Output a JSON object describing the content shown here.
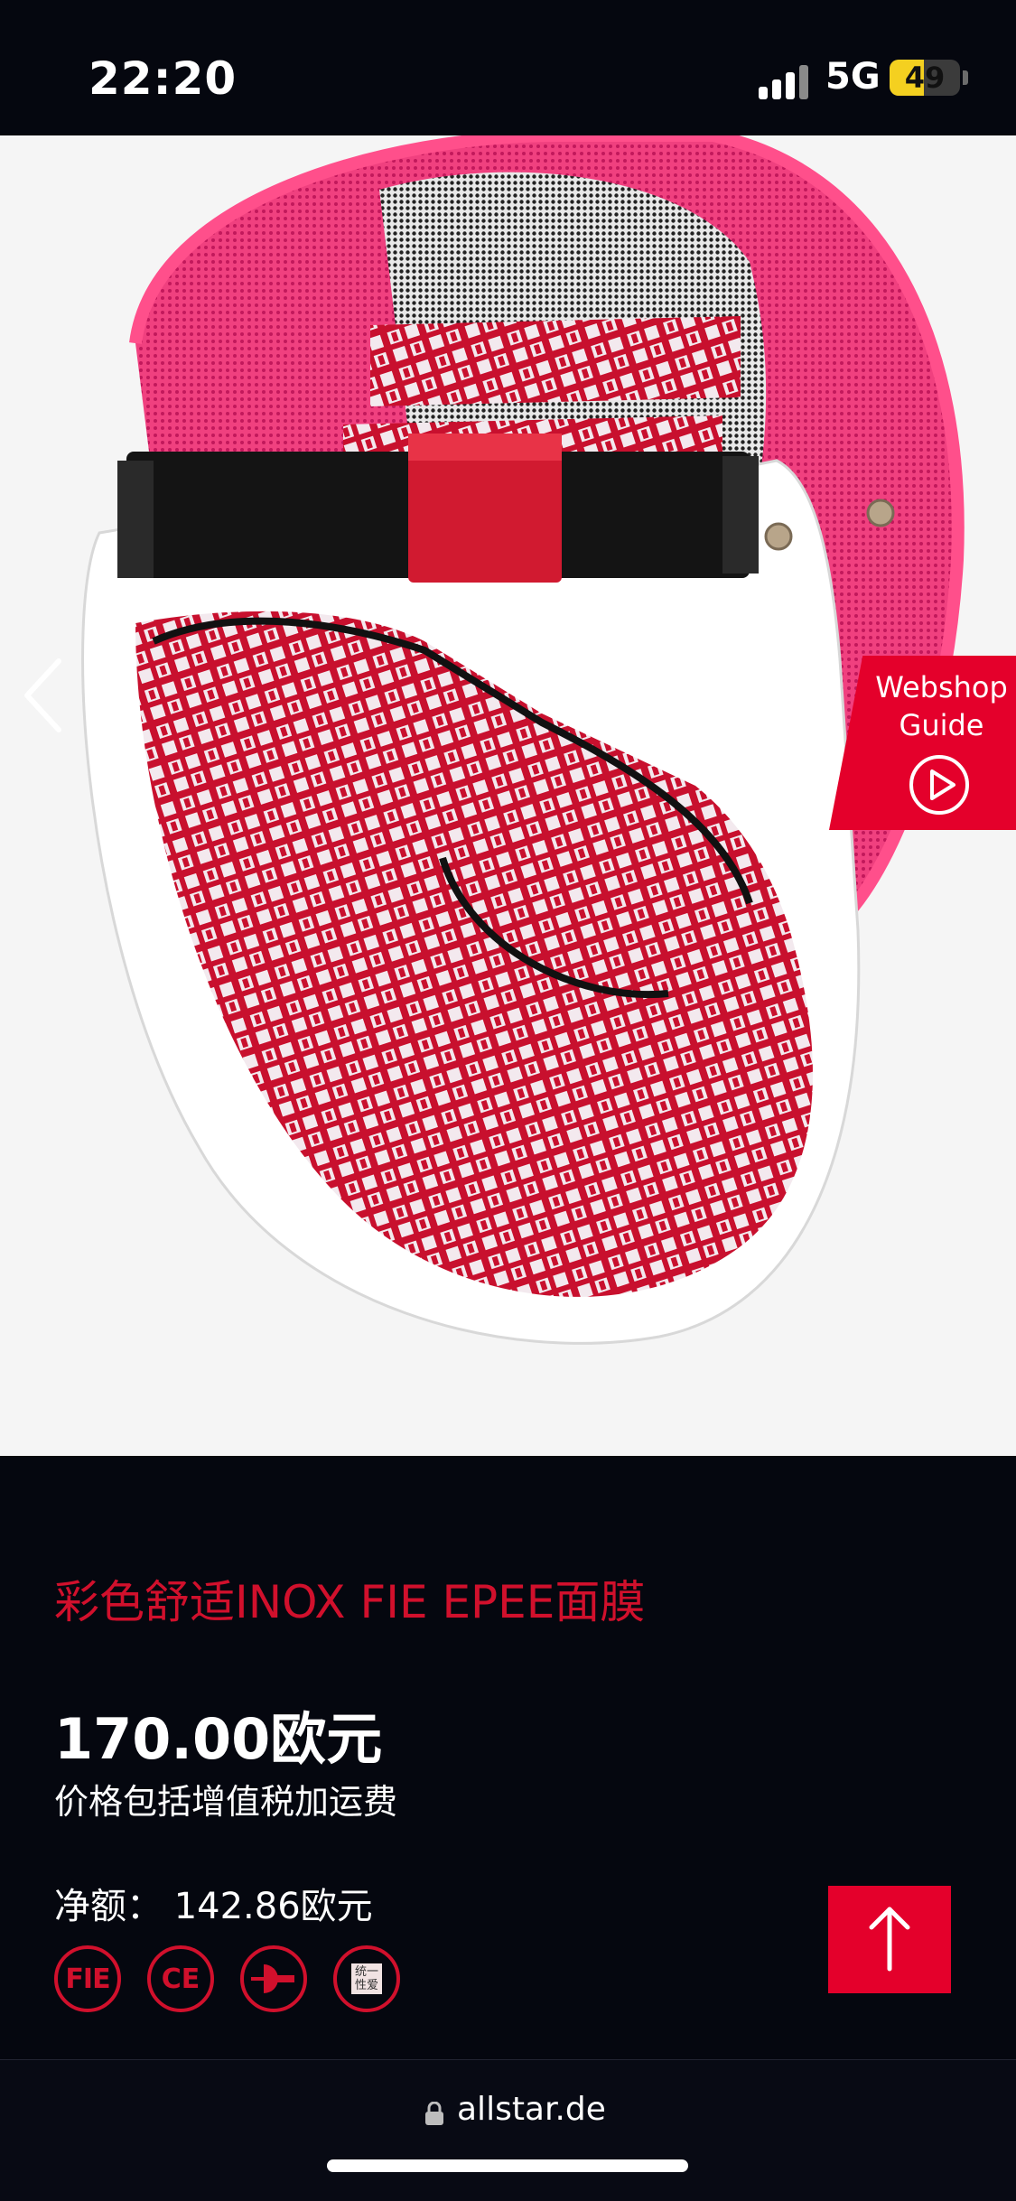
{
  "status_bar": {
    "time": "22:20",
    "network": "5G",
    "battery_level": "49",
    "battery_fraction": 0.49,
    "battery_color": "#f4d020"
  },
  "product": {
    "image_name": "fencing-mask-image",
    "title": "彩色舒适INOX FIE EPEE面膜",
    "price": "170.00欧元",
    "price_note": "价格包括增值税加运费",
    "net_price": "净额：  142.86欧元",
    "certifications": [
      {
        "name": "FIE",
        "label": "FIE"
      },
      {
        "name": "CE",
        "label": "CE"
      },
      {
        "name": "plug",
        "label": ""
      },
      {
        "name": "unisex",
        "label": "统一性爱"
      }
    ]
  },
  "guide": {
    "line1": "Webshop",
    "line2": "Guide"
  },
  "icons": {
    "prev": "chevron-left-icon",
    "play": "play-icon",
    "scroll_top": "arrow-up-icon",
    "lock": "lock-icon"
  },
  "colors": {
    "accent": "#e4002b",
    "title_red": "#d1102c",
    "background": "#05070f"
  },
  "browser": {
    "url": "allstar.de"
  }
}
